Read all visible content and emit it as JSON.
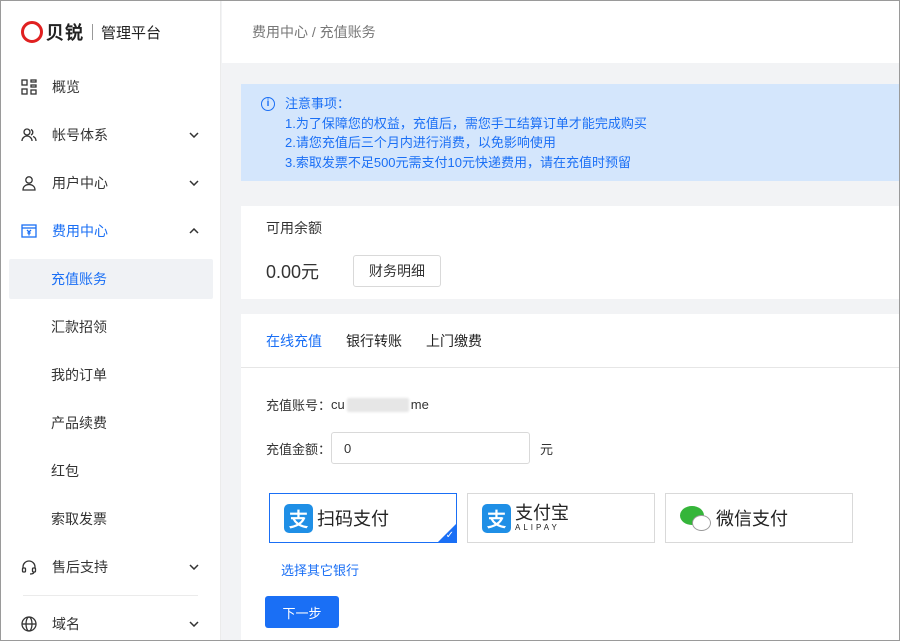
{
  "brand": {
    "name": "贝锐",
    "subtitle": "管理平台"
  },
  "breadcrumb": "费用中心 / 充值账务",
  "sidebar": {
    "items": [
      {
        "label": "概览",
        "icon": "grid-icon"
      },
      {
        "label": "帐号体系",
        "icon": "users-icon"
      },
      {
        "label": "用户中心",
        "icon": "user-icon"
      },
      {
        "label": "费用中心",
        "icon": "yen-card-icon",
        "expanded": true
      },
      {
        "label": "售后支持",
        "icon": "headset-icon"
      },
      {
        "label": "域名",
        "icon": "globe-icon"
      }
    ],
    "sub_items": [
      "充值账务",
      "汇款招领",
      "我的订单",
      "产品续费",
      "红包",
      "索取发票"
    ],
    "selected_sub": "充值账务"
  },
  "notice": {
    "title": "注意事项：",
    "lines": [
      "1.为了保障您的权益，充值后，需您手工结算订单才能完成购买",
      "2.请您充值后三个月内进行消费，以免影响使用",
      "3.索取发票不足500元需支付10元快递费用，请在充值时预留"
    ]
  },
  "balance": {
    "title": "可用余额",
    "amount": "0.00元",
    "detail_button": "财务明细"
  },
  "tabs": [
    "在线充值",
    "银行转账",
    "上门缴费"
  ],
  "active_tab": "在线充值",
  "form": {
    "account_label": "充值账号：",
    "account_prefix": "cu",
    "account_suffix": "me",
    "amount_label": "充值金额：",
    "amount_value": "0",
    "unit": "元"
  },
  "payments": [
    {
      "label": "扫码支付",
      "selected": true
    },
    {
      "label": "支付宝",
      "sub": "ALIPAY",
      "selected": false
    },
    {
      "label": "微信支付",
      "selected": false
    }
  ],
  "other_bank": "选择其它银行",
  "next_button": "下一步",
  "colors": {
    "primary": "#1a6ff5",
    "notice_bg": "#d4e6fc",
    "alipay": "#1f8fe6",
    "wechat": "#35b53a",
    "brand_red": "#e02020"
  }
}
